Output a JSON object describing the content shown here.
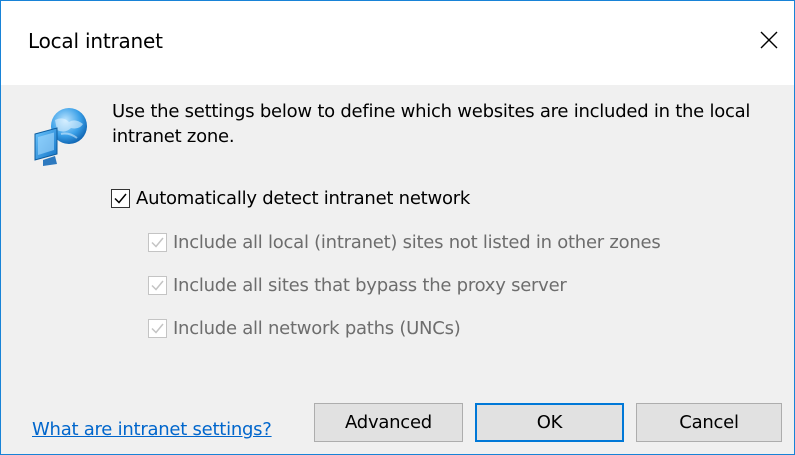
{
  "dialog": {
    "title": "Local intranet",
    "description": "Use the settings below to define which websites are included in the local intranet zone."
  },
  "checkboxes": {
    "auto_detect": {
      "label": "Automatically detect intranet network",
      "checked": true,
      "enabled": true
    },
    "include_local": {
      "label": "Include all local (intranet) sites not listed in other zones",
      "checked": true,
      "enabled": false
    },
    "include_bypass": {
      "label": "Include all sites that bypass the proxy server",
      "checked": true,
      "enabled": false
    },
    "include_unc": {
      "label": "Include all network paths (UNCs)",
      "checked": true,
      "enabled": false
    }
  },
  "footer": {
    "help_link": "What are intranet settings?",
    "advanced_label": "Advanced",
    "ok_label": "OK",
    "cancel_label": "Cancel"
  },
  "icons": {
    "close": "close-icon",
    "globe": "globe-monitor-icon",
    "check": "checkmark-icon"
  },
  "colors": {
    "accent": "#0078d7",
    "link": "#0066cc",
    "disabled_text": "#6d6d6d"
  }
}
